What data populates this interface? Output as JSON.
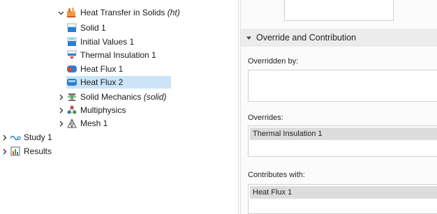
{
  "tree": {
    "heat_transfer": {
      "label": "Heat Transfer in Solids",
      "suffix": "(ht)"
    },
    "solid1": "Solid 1",
    "initial_values": "Initial Values 1",
    "thermal_insulation": "Thermal Insulation 1",
    "heat_flux1": "Heat Flux 1",
    "heat_flux2": "Heat Flux 2",
    "solid_mechanics": {
      "label": "Solid Mechanics",
      "suffix": "(solid)"
    },
    "multiphysics": "Multiphysics",
    "mesh": "Mesh 1",
    "study": "Study 1",
    "results": "Results"
  },
  "settings": {
    "section_title": "Override and Contribution",
    "overridden_by_label": "Overridden by:",
    "overrides_label": "Overrides:",
    "overrides_items": [
      "Thermal Insulation 1"
    ],
    "contributes_label": "Contributes with:",
    "contributes_items": [
      "Heat Flux 1"
    ]
  },
  "colors": {
    "selection": "#cce4f7",
    "section_header": "#ececec",
    "list_item": "#dcdcdc"
  }
}
